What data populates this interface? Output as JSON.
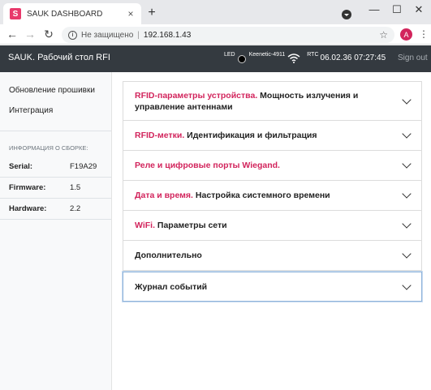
{
  "browser": {
    "tab_title": "SAUK DASHBOARD",
    "favicon_letter": "S",
    "tab_close": "×",
    "new_tab": "+",
    "minimize": "—",
    "maximize": "☐",
    "close": "✕",
    "back": "←",
    "forward": "→",
    "reload": "↻",
    "info_glyph": "i",
    "security_text": "Не защищено",
    "separator": "|",
    "url": "192.168.1.43",
    "star": "☆",
    "profile_letter": "A",
    "menu": "⋮"
  },
  "header": {
    "brand": "SAUK. Рабочий стол RFID",
    "led_label": "LED",
    "network_name": "Keenetic-4911",
    "rtc_label": "RTC",
    "datetime": "06.02.36 07:27:45",
    "signout": "Sign out"
  },
  "sidebar": {
    "links": [
      {
        "label": "Обновление прошивки"
      },
      {
        "label": "Интеграция"
      }
    ],
    "build_heading": "ИНФОРМАЦИЯ О СБОРКЕ:",
    "build_info": [
      {
        "key": "Serial:",
        "value": "F19A29"
      },
      {
        "key": "Firmware:",
        "value": "1.5"
      },
      {
        "key": "Hardware:",
        "value": "2.2"
      }
    ]
  },
  "sections": [
    {
      "accent": "RFID-параметры устройства.",
      "title": " Мощность излучения и управление антеннами"
    },
    {
      "accent": "RFID-метки.",
      "title": " Идентификация и фильтрация"
    },
    {
      "accent": "Реле и цифровые порты Wiegand.",
      "title": ""
    },
    {
      "accent": "Дата и время.",
      "title": " Настройка системного времени"
    },
    {
      "accent": "WiFi.",
      "title": " Параметры сети"
    },
    {
      "accent": "",
      "title": "Дополнительно"
    },
    {
      "accent": "",
      "title": "Журнал событий"
    }
  ],
  "colors": {
    "accent": "#d2245c",
    "header_bg": "#343a40",
    "sidebar_bg": "#f8f9fa"
  }
}
